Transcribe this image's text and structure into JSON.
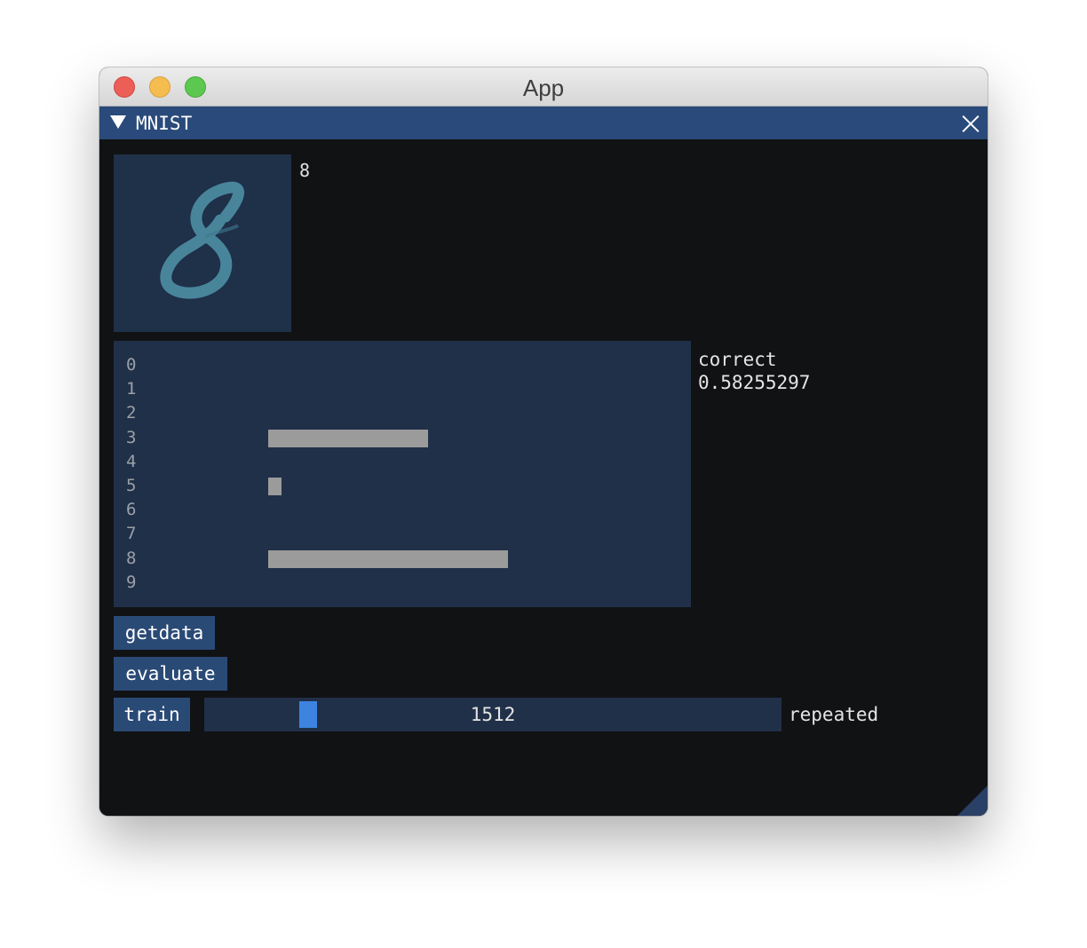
{
  "app": {
    "title": "App"
  },
  "panel": {
    "title": "MNIST",
    "collapse_icon": "triangle-down-icon",
    "close_icon": "close-x-icon"
  },
  "sample": {
    "image_description_icon": "handwritten-digit-image",
    "label": "8"
  },
  "chart_data": {
    "type": "bar",
    "orientation": "horizontal",
    "categories": [
      "0",
      "1",
      "2",
      "3",
      "4",
      "5",
      "6",
      "7",
      "8",
      "9"
    ],
    "values": [
      0,
      0,
      0,
      0.36,
      0,
      0.03,
      0,
      0,
      0.54,
      0
    ],
    "xlim": [
      0,
      1
    ],
    "bar_color": "#9b9b9b",
    "background_color": "#213049"
  },
  "result": {
    "caption": "correct",
    "value": "0.58255297"
  },
  "buttons": {
    "getdata": "getdata",
    "evaluate": "evaluate",
    "train": "train"
  },
  "slider": {
    "value": "1512",
    "fraction": 0.17,
    "label": "repeated"
  },
  "colors": {
    "accent": "#3d84e0",
    "title_bg": "#294a7a",
    "window_bg": "#111214"
  }
}
